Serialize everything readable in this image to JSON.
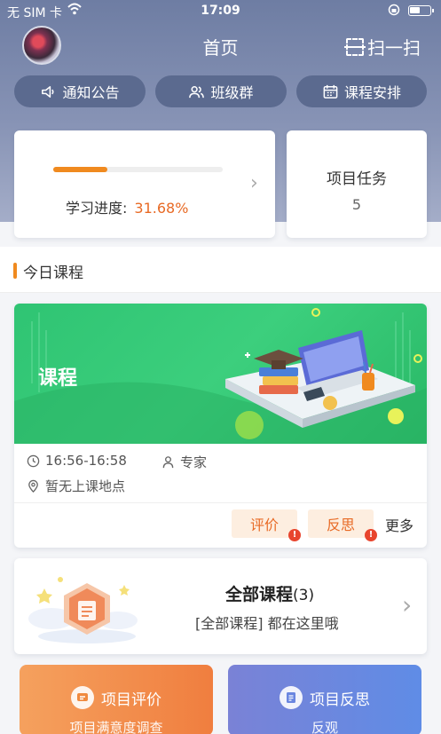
{
  "status_bar": {
    "carrier": "无 SIM 卡",
    "time": "17:09"
  },
  "header": {
    "title": "首页",
    "scan_label": "扫一扫"
  },
  "quick_nav": [
    {
      "label": "通知公告",
      "icon": "speaker-icon"
    },
    {
      "label": "班级群",
      "icon": "group-icon"
    },
    {
      "label": "课程安排",
      "icon": "calendar-icon"
    }
  ],
  "progress": {
    "label": "学习进度:",
    "value": "31.68%",
    "fraction": 0.3168
  },
  "task": {
    "label": "项目任务",
    "count": "5"
  },
  "today": {
    "title": "今日课程"
  },
  "course": {
    "banner_title": "课程",
    "time": "16:56-16:58",
    "teacher": "专家",
    "location": "暂无上课地点",
    "evaluate": "评价",
    "reflect": "反思",
    "badge": "!",
    "more": "更多"
  },
  "all_courses": {
    "title": "全部课程",
    "count": "(3)",
    "subtitle": "[全部课程] 都在这里哦"
  },
  "bottom": [
    {
      "title": "项目评价",
      "subtitle": "项目满意度调查"
    },
    {
      "title": "项目反思",
      "subtitle": "反观"
    }
  ],
  "colors": {
    "accent": "#f08a1f",
    "header": "#7584a8",
    "banner": "#34c776"
  }
}
